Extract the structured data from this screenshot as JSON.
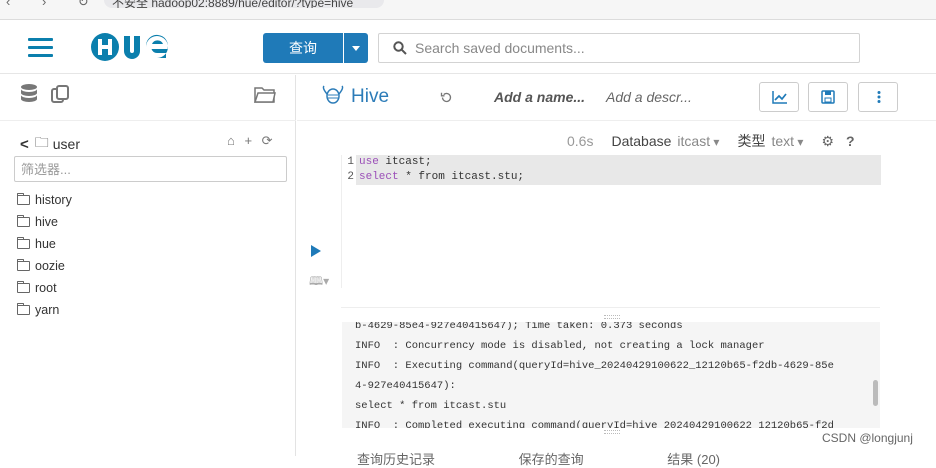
{
  "browser": {
    "nav_glyphs": "‹ › ↻",
    "url": "不安全  hadoop02:8889/hue/editor/?type=hive"
  },
  "topnav": {
    "menu_icon": "hamburger-icon",
    "logo": "HUE",
    "query_button": "查询",
    "search_placeholder": "Search saved documents..."
  },
  "left": {
    "path": "user",
    "filter_placeholder": "筛选器...",
    "actions": "⌂ + ⟳",
    "folders": [
      "history",
      "hive",
      "hue",
      "oozie",
      "root",
      "yarn"
    ]
  },
  "editor": {
    "type": "Hive",
    "name_placeholder": "Add a name...",
    "desc_placeholder": "Add a descr...",
    "exec_time": "0.6s",
    "database_label": "Database",
    "database_value": "itcast",
    "type_label": "类型",
    "type_value": "text",
    "help": "?",
    "code_lines": [
      {
        "n": "1",
        "kw": "use",
        "rest": " itcast;"
      },
      {
        "n": "2",
        "kw": "select",
        "rest": " * from itcast.stu;"
      }
    ]
  },
  "log": {
    "lines": [
      "b-4629-85e4-927e40415647); Time taken: 0.373 seconds",
      "INFO  : Concurrency mode is disabled, not creating a lock manager",
      "INFO  : Executing command(queryId=hive_20240429100622_12120b65-f2db-4629-85e",
      "4-927e40415647):",
      "select * from itcast.stu",
      "INFO  : Completed executing command(queryId=hive_20240429100622_12120b65-f2d"
    ]
  },
  "result_tabs": [
    "查询历史记录",
    "保存的查询",
    "结果 (20)"
  ],
  "watermark": "CSDN @longjunj",
  "colors": {
    "accent": "#1F7AB8",
    "logo": "#0B7FAD"
  }
}
